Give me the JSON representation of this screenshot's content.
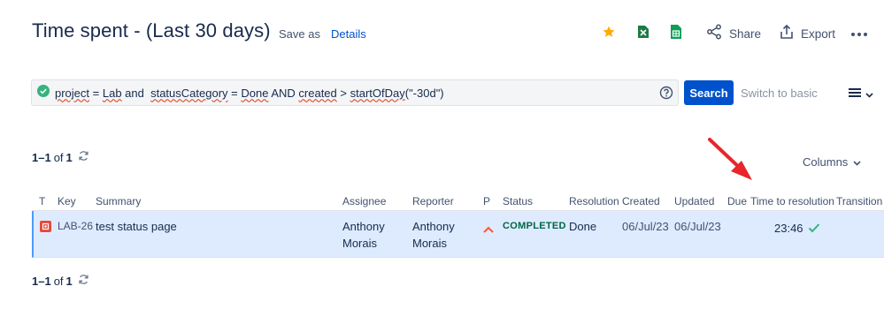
{
  "header": {
    "title": "Time spent - (Last 30 days)",
    "save_as": "Save as",
    "details": "Details",
    "share": "Share",
    "export": "Export"
  },
  "icons": {
    "star": "star-icon",
    "excel": "excel-icon",
    "sheets": "google-sheets-icon",
    "share": "share-icon",
    "export": "export-icon",
    "more": "more-icon",
    "valid": "check-circle-icon",
    "help": "help-icon",
    "list": "list-view-icon",
    "refresh": "refresh-icon",
    "chevron": "chevron-down-icon",
    "priority": "priority-major-icon",
    "issue_type": "bug-icon",
    "resolved": "check-icon",
    "annotation": "arrow-icon"
  },
  "colors": {
    "primary": "#0052cc",
    "row_selected": "#deebff",
    "status_done": "#006644",
    "arrow": "#e8262b",
    "star": "#ffab00",
    "excel": "#1d7a44",
    "sheets": "#0f9d58"
  },
  "query": {
    "parts": {
      "p1": "project",
      "p2": " = ",
      "p3": "Lab",
      "p4": " and  ",
      "p5": "statusCategory",
      "p6": " = ",
      "p7": "Done",
      "p8": " AND ",
      "p9": "created",
      "p10": " > ",
      "p11": "startOfDay",
      "p12": "(\"-30d\")"
    },
    "search_label": "Search",
    "switch_label": "Switch to basic"
  },
  "pagination": {
    "range": "1–1",
    "of": "of",
    "total": "1"
  },
  "columns_label": "Columns",
  "table": {
    "headers": {
      "t": "T",
      "key": "Key",
      "summary": "Summary",
      "assignee": "Assignee",
      "reporter": "Reporter",
      "p": "P",
      "status": "Status",
      "resolution": "Resolution",
      "created": "Created",
      "updated": "Updated",
      "due": "Due",
      "time_to_resolution": "Time to resolution",
      "transition": "Transition"
    },
    "rows": [
      {
        "key": "LAB-26",
        "summary": "test status page",
        "assignee_first": "Anthony",
        "assignee_last": "Morais",
        "reporter_first": "Anthony",
        "reporter_last": "Morais",
        "status": "COMPLETED",
        "resolution": "Done",
        "created": "06/Jul/23",
        "updated": "06/Jul/23",
        "time_to_resolution": "23:46"
      }
    ]
  }
}
